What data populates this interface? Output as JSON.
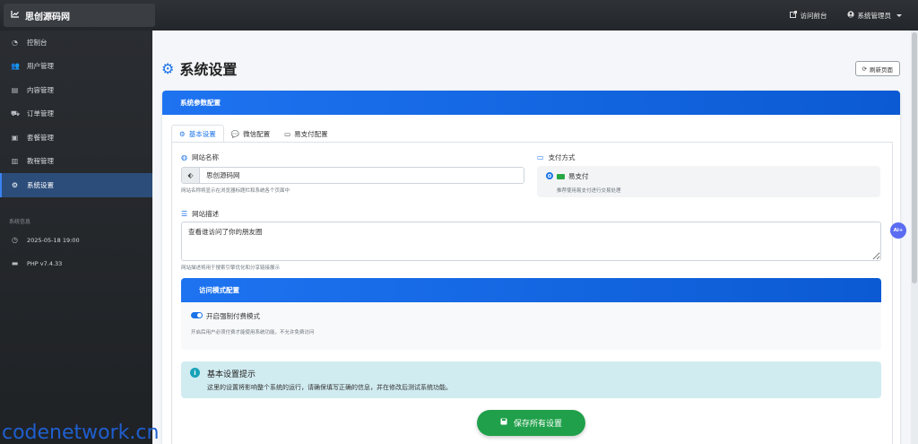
{
  "brand": {
    "title": "思创源码网",
    "icon": "chart-line-icon"
  },
  "topbar": {
    "visit_front": "访问前台",
    "admin_user": "系统管理员"
  },
  "sidebar": {
    "items": [
      {
        "label": "控制台",
        "icon": "dashboard-icon",
        "active": false
      },
      {
        "label": "用户管理",
        "icon": "users-icon",
        "active": false
      },
      {
        "label": "内容管理",
        "icon": "file-icon",
        "active": false
      },
      {
        "label": "订单管理",
        "icon": "cart-icon",
        "active": false
      },
      {
        "label": "套餐管理",
        "icon": "box-icon",
        "active": false
      },
      {
        "label": "教程管理",
        "icon": "book-icon",
        "active": false
      },
      {
        "label": "系统设置",
        "icon": "gear-icon",
        "active": true
      }
    ],
    "section_title": "系统信息",
    "info": {
      "datetime": "2025-05-18 19:00",
      "php": "PHP v7.4.33"
    }
  },
  "page": {
    "title": "系统设置",
    "refresh": "刷新页面"
  },
  "card": {
    "title": "系统参数配置"
  },
  "tabs": [
    {
      "label": "基本设置",
      "active": true
    },
    {
      "label": "微信配置",
      "active": false
    },
    {
      "label": "易支付配置",
      "active": false
    }
  ],
  "site_name": {
    "label": "网站名称",
    "value": "思创源码网",
    "help": "网站名称将显示在浏览器标题栏和系统各个页面中"
  },
  "payment": {
    "label": "支付方式",
    "option": "易支付",
    "help": "推荐使用易支付进行交易处理"
  },
  "site_desc": {
    "label": "网站描述",
    "value": "查看谁访问了你的朋友圈",
    "help": "网站描述将用于搜索引擎优化和分享链接展示"
  },
  "access_mode": {
    "title": "访问模式配置",
    "toggle_label": "开启强制付费模式",
    "help": "开启后用户必须付费才能使用系统功能，不允许免费访问",
    "enabled": true
  },
  "alert": {
    "title": "基本设置提示",
    "text": "这里的设置将影响整个系统的运行，请确保填写正确的信息，并在修改后测试系统功能。"
  },
  "save_button": "保存所有设置",
  "ai_badge": "Ai+",
  "watermark": "codenetwork.cn",
  "colors": {
    "primary": "#1a73e8",
    "sidebar_bg": "#23262a",
    "success": "#20a04a",
    "info_bg": "#d1ecf1"
  }
}
